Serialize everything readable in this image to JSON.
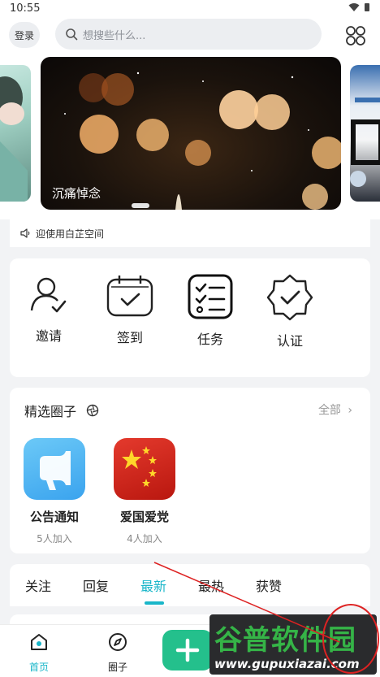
{
  "status_bar": {
    "time": "10:55"
  },
  "header": {
    "login_label": "登录",
    "search_placeholder": "想搜些什么..."
  },
  "banner": {
    "caption": "沉痛悼念"
  },
  "notice": {
    "text": "迎使用白芷空间"
  },
  "quick_actions": [
    {
      "label": "邀请",
      "icon": "invite-user-icon"
    },
    {
      "label": "签到",
      "icon": "calendar-check-icon"
    },
    {
      "label": "任务",
      "icon": "task-list-icon"
    },
    {
      "label": "认证",
      "icon": "verified-badge-icon"
    }
  ],
  "circles": {
    "title": "精选圈子",
    "more_label": "全部",
    "items": [
      {
        "name": "公告通知",
        "count": "5人加入",
        "icon": "megaphone-icon",
        "color": "#4fb3f2"
      },
      {
        "name": "爱国爱党",
        "count": "4人加入",
        "icon": "flag-icon",
        "color": "#d6231a"
      }
    ]
  },
  "feed_tabs": {
    "items": [
      "关注",
      "回复",
      "最新",
      "最热",
      "获赞"
    ],
    "active_index": 2,
    "accent": "#19b6c9"
  },
  "bottom_nav": {
    "items": [
      {
        "label": "首页",
        "icon": "home-icon",
        "active": true
      },
      {
        "label": "圈子",
        "icon": "compass-icon",
        "active": false
      }
    ],
    "active_color": "#19b6c9",
    "fab_color": "#24c08c"
  },
  "watermark": {
    "title": "谷普软件园",
    "url": "www.gupuxiazai.com"
  }
}
